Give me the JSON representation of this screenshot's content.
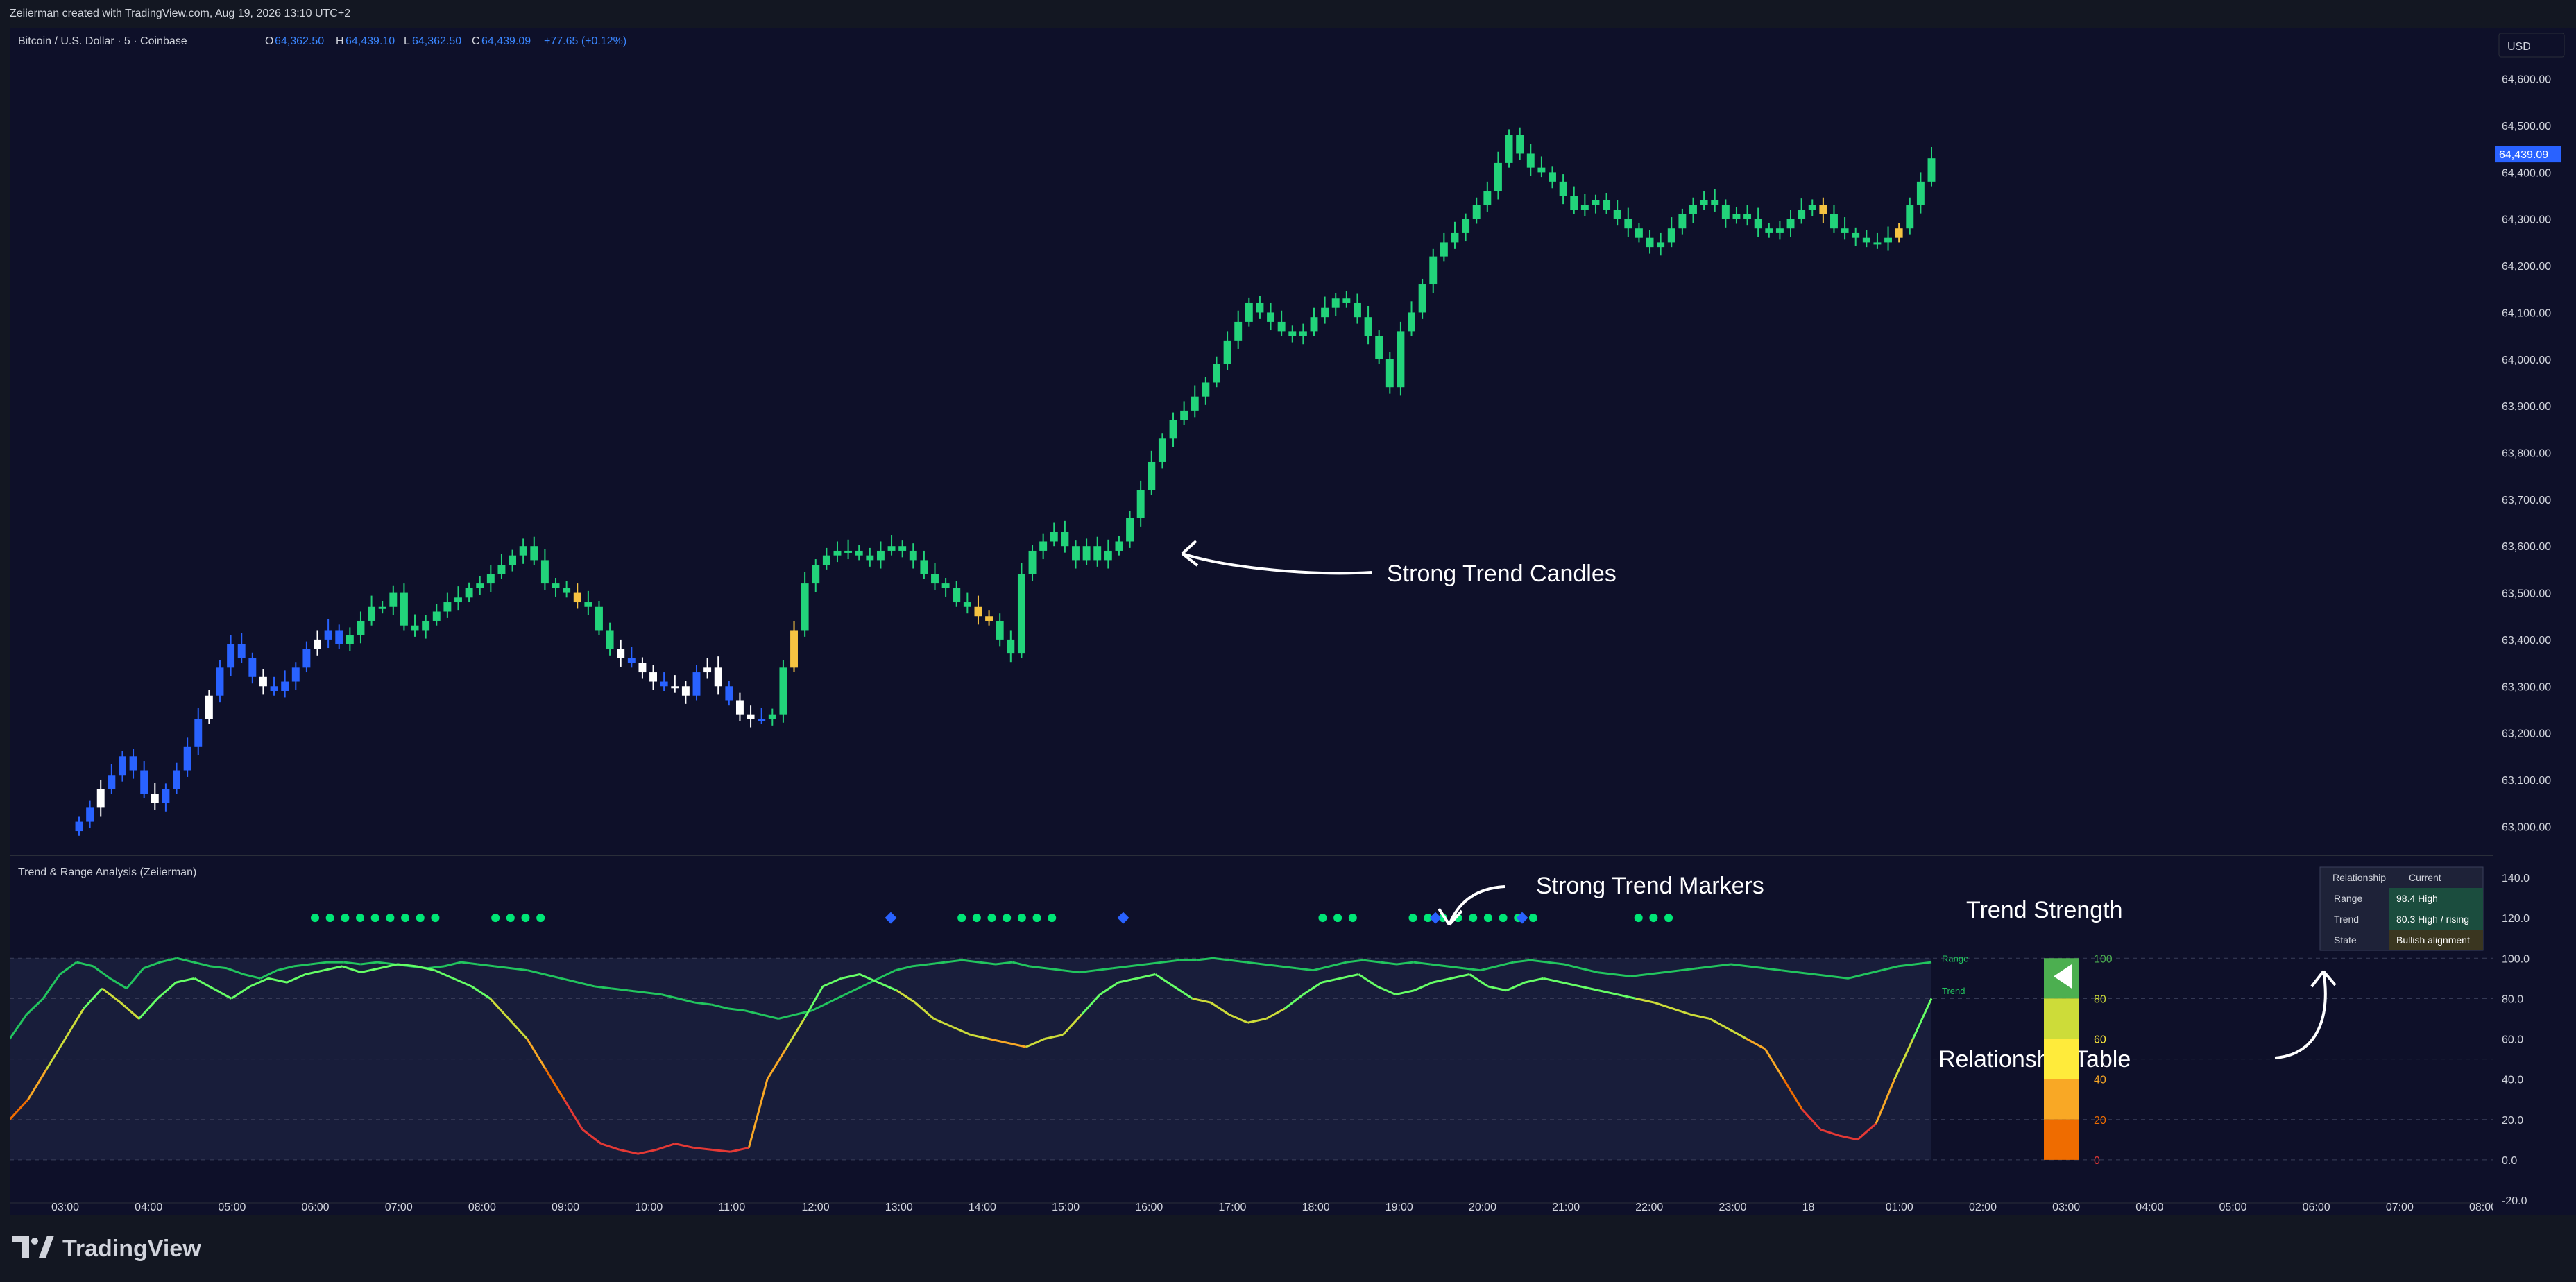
{
  "header": {
    "credit": "Zeiierman created with TradingView.com, Aug 19, 2026 13:10 UTC+2"
  },
  "symbol_bar": {
    "title": "Bitcoin / U.S. Dollar · 5 · Coinbase",
    "o_label": "O",
    "o_value": "64,362.50",
    "h_label": "H",
    "h_value": "64,439.10",
    "l_label": "L",
    "l_value": "64,362.50",
    "c_label": "C",
    "c_value": "64,439.09",
    "change": "+77.65 (+0.12%)"
  },
  "currency_button": "USD",
  "price_axis": {
    "labels": [
      "64,600.00",
      "64,500.00",
      "64,400.00",
      "64,300.00",
      "64,200.00",
      "64,100.00",
      "64,000.00",
      "63,900.00",
      "63,800.00",
      "63,700.00",
      "63,600.00",
      "63,500.00",
      "63,400.00",
      "63,300.00",
      "63,200.00",
      "63,100.00",
      "63,000.00"
    ],
    "current_price": "64,439.09"
  },
  "indicator": {
    "title": "Trend & Range Analysis (Zeiierman)",
    "axis_labels": [
      "140.0",
      "120.0",
      "100.0",
      "80.0",
      "60.0",
      "40.0",
      "20.0",
      "0.0",
      "-20.0"
    ],
    "range_label": "Range",
    "trend_label": "Trend",
    "strength_title": "Trend Strength",
    "strength_levels": [
      "100",
      "80",
      "60",
      "40",
      "20",
      "0"
    ],
    "strength_colors": [
      "#4caf50",
      "#cddc39",
      "#ffeb3b",
      "#f9a825",
      "#ef6c00",
      "#e53935"
    ],
    "table": {
      "headers": [
        "Relationship",
        "Current"
      ],
      "rows": [
        {
          "name": "Range",
          "value": "98.4  High"
        },
        {
          "name": "Trend",
          "value": "80.3  High / rising"
        },
        {
          "name": "State",
          "value": "Bullish alignment"
        }
      ]
    }
  },
  "annotations": {
    "candles": "Strong Trend Candles",
    "markers": "Strong Trend Markers",
    "table": "Relationship Table"
  },
  "time_axis": [
    "03:00",
    "04:00",
    "05:00",
    "06:00",
    "07:00",
    "08:00",
    "09:00",
    "10:00",
    "11:00",
    "12:00",
    "13:00",
    "14:00",
    "15:00",
    "16:00",
    "17:00",
    "18:00",
    "19:00",
    "20:00",
    "21:00",
    "22:00",
    "23:00",
    "18",
    "01:00",
    "02:00",
    "03:00",
    "04:00",
    "05:00",
    "06:00",
    "07:00",
    "08:00"
  ],
  "branding": "TradingView",
  "colors": {
    "strong_up": "#22d37a",
    "up": "#2ecc71",
    "down": "#26c281",
    "weak": "#f6c342",
    "bear": "#2962ff",
    "neutral": "#ffffff",
    "range_line": "#22c55e",
    "marker_green": "#00e676",
    "marker_blue": "#2962ff"
  },
  "chart_data": {
    "type": "candlestick",
    "price_series": {
      "close": [
        63010,
        63040,
        63080,
        63110,
        63150,
        63120,
        63070,
        63050,
        63080,
        63120,
        63170,
        63230,
        63280,
        63340,
        63390,
        63360,
        63320,
        63300,
        63290,
        63310,
        63340,
        63380,
        63400,
        63420,
        63390,
        63410,
        63440,
        63470,
        63470,
        63500,
        63430,
        63420,
        63440,
        63460,
        63480,
        63490,
        63510,
        63520,
        63540,
        63560,
        63580,
        63600,
        63570,
        63520,
        63510,
        63500,
        63480,
        63470,
        63420,
        63380,
        63360,
        63350,
        63330,
        63310,
        63300,
        63300,
        63280,
        63330,
        63340,
        63300,
        63270,
        63240,
        63230,
        63230,
        63240,
        63340,
        63420,
        63520,
        63560,
        63580,
        63590,
        63590,
        63580,
        63570,
        63590,
        63600,
        63590,
        63570,
        63540,
        63520,
        63510,
        63480,
        63470,
        63450,
        63440,
        63400,
        63370,
        63540,
        63590,
        63610,
        63630,
        63600,
        63570,
        63600,
        63570,
        63590,
        63610,
        63660,
        63720,
        63780,
        63830,
        63870,
        63890,
        63920,
        63950,
        63990,
        64040,
        64080,
        64120,
        64100,
        64080,
        64060,
        64050,
        64060,
        64090,
        64110,
        64130,
        64120,
        64090,
        64050,
        64000,
        63940,
        64060,
        64100,
        64160,
        64220,
        64250,
        64270,
        64300,
        64330,
        64360,
        64420,
        64480,
        64440,
        64410,
        64400,
        64380,
        64350,
        64320,
        64330,
        64340,
        64320,
        64300,
        64280,
        64260,
        64240,
        64250,
        64280,
        64310,
        64330,
        64340,
        64330,
        64300,
        64310,
        64300,
        64280,
        64270,
        64280,
        64300,
        64320,
        64330,
        64310,
        64280,
        64270,
        64260,
        64250,
        64250,
        64260,
        64280,
        64330,
        64380,
        64430
      ],
      "candle_class_legend": [
        "strong-trend (green)",
        "weak (yellow)",
        "bearish range (blue)",
        "neutral (white)"
      ]
    },
    "indicator_series": {
      "range": [
        60,
        72,
        80,
        92,
        98,
        96,
        90,
        85,
        95,
        98,
        100,
        98,
        96,
        95,
        92,
        90,
        94,
        96,
        97,
        98,
        98,
        97,
        98,
        97,
        96,
        95,
        96,
        98,
        97,
        96,
        95,
        94,
        92,
        90,
        88,
        86,
        85,
        84,
        83,
        82,
        80,
        78,
        77,
        75,
        74,
        72,
        70,
        72,
        74,
        78,
        82,
        86,
        90,
        94,
        96,
        97,
        98,
        99,
        98,
        97,
        98,
        96,
        95,
        94,
        93,
        94,
        95,
        96,
        97,
        98,
        99,
        99,
        100,
        99,
        98,
        97,
        96,
        95,
        94,
        96,
        98,
        99,
        98,
        97,
        98,
        97,
        96,
        95,
        94,
        96,
        98,
        99,
        98,
        97,
        95,
        93,
        92,
        91,
        92,
        93,
        94,
        95,
        96,
        97,
        96,
        95,
        94,
        93,
        92,
        91,
        90,
        92,
        94,
        96,
        97,
        98
      ],
      "trend": [
        20,
        30,
        45,
        60,
        75,
        85,
        78,
        70,
        80,
        88,
        90,
        85,
        80,
        86,
        90,
        88,
        92,
        94,
        96,
        93,
        95,
        97,
        96,
        94,
        90,
        86,
        80,
        70,
        60,
        45,
        30,
        15,
        8,
        5,
        3,
        5,
        8,
        6,
        5,
        4,
        6,
        40,
        55,
        70,
        86,
        90,
        92,
        88,
        84,
        78,
        70,
        66,
        62,
        60,
        58,
        56,
        60,
        62,
        72,
        82,
        88,
        90,
        92,
        86,
        80,
        78,
        72,
        68,
        70,
        75,
        82,
        88,
        90,
        92,
        86,
        82,
        84,
        88,
        90,
        92,
        86,
        84,
        88,
        90,
        88,
        86,
        84,
        82,
        80,
        78,
        75,
        72,
        70,
        65,
        60,
        55,
        40,
        25,
        15,
        12,
        10,
        18,
        40,
        60,
        80
      ]
    },
    "y_range_price": [
      62950,
      64650
    ],
    "y_range_indicator": [
      -20,
      140
    ]
  }
}
